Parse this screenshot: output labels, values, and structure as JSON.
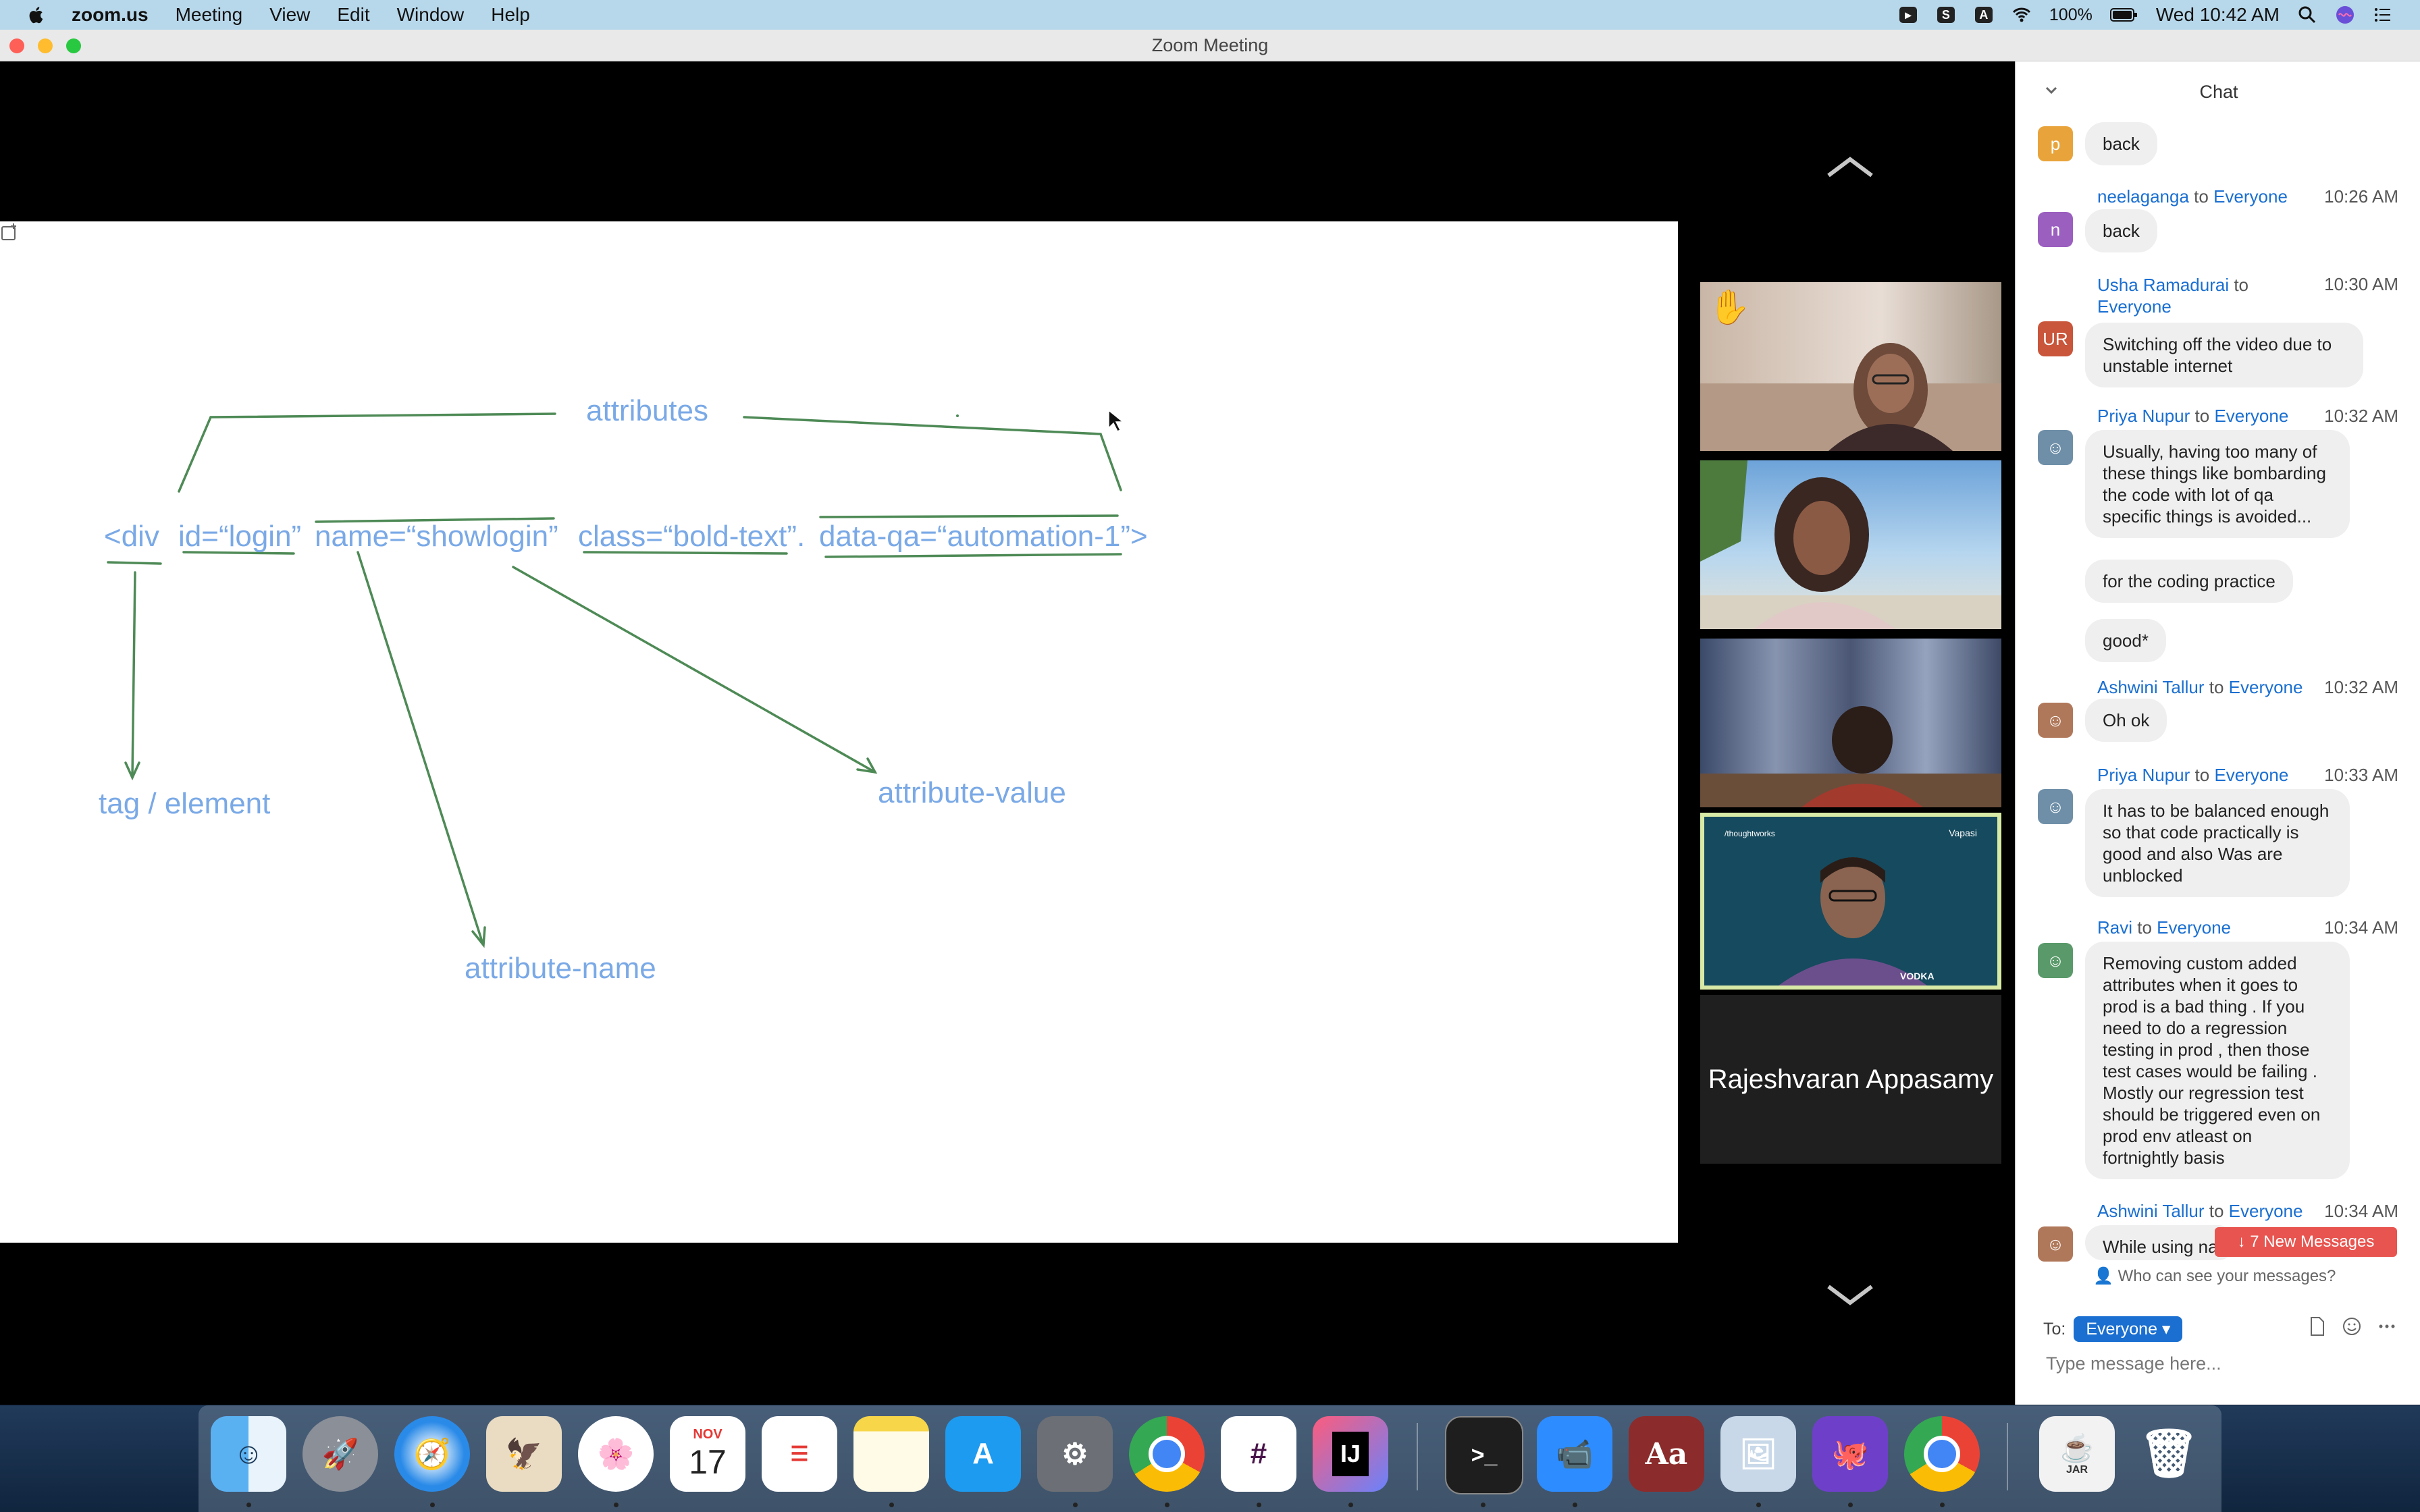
{
  "menubar": {
    "app": "zoom.us",
    "items": [
      "Meeting",
      "View",
      "Edit",
      "Window",
      "Help"
    ],
    "status_a": "A",
    "battery": "100%",
    "clock": "Wed 10:42 AM"
  },
  "window": {
    "title": "Zoom Meeting"
  },
  "whiteboard": {
    "attributes": "attributes",
    "tag_code": "<div",
    "id_code": "id=“login”",
    "name_code": "name=“showlogin”",
    "class_code": "class=“bold-text”.",
    "dataqa_code": "data-qa=“automation-1”>",
    "tag_label": "tag / element",
    "attr_value_label": "attribute-value",
    "attr_name_label": "attribute-name"
  },
  "participants": {
    "tile4_brand_left": "/thoughtworks",
    "tile4_brand_right": "Vapasi",
    "tile4_shirt": "VODKA",
    "name_tile": "Rajeshvaran Appasamy"
  },
  "chat": {
    "title": "Chat",
    "to_word": "to",
    "messages": [
      {
        "avatar": "p",
        "avatar_color": "#e8a43a",
        "sender": "",
        "recipient": "",
        "time": "",
        "text": "back"
      },
      {
        "avatar": "n",
        "avatar_color": "#9b5fc0",
        "sender": "neelaganga",
        "recipient": "Everyone",
        "time": "10:26 AM",
        "text": "back"
      },
      {
        "avatar": "UR",
        "avatar_color": "#c9553a",
        "sender": "Usha Ramadurai",
        "recipient": "Everyone",
        "time": "10:30 AM",
        "text": "Switching off the video due to unstable internet"
      },
      {
        "avatar": "",
        "avatar_color": "#6f8fa8",
        "sender": "Priya Nupur",
        "recipient": "Everyone",
        "time": "10:32 AM",
        "text": "Usually, having too many of these things like bombarding the code with lot of qa specific things is avoided..."
      },
      {
        "avatar": "",
        "avatar_color": "",
        "sender": "",
        "recipient": "",
        "time": "",
        "text": "for the coding practice"
      },
      {
        "avatar": "",
        "avatar_color": "",
        "sender": "",
        "recipient": "",
        "time": "",
        "text": "good*"
      },
      {
        "avatar": "",
        "avatar_color": "#b0785a",
        "sender": "Ashwini Tallur",
        "recipient": "Everyone",
        "time": "10:32 AM",
        "text": "Oh ok"
      },
      {
        "avatar": "",
        "avatar_color": "#6f8fa8",
        "sender": "Priya Nupur",
        "recipient": "Everyone",
        "time": "10:33 AM",
        "text": "It has to be balanced enough so that code practically is good and also Was are unblocked"
      },
      {
        "avatar": "",
        "avatar_color": "#5a9a6a",
        "sender": "Ravi",
        "recipient": "Everyone",
        "time": "10:34 AM",
        "text": "Removing custom added attributes when it goes to prod is a bad thing . If you need to do a regression testing in prod , then those test cases would be failing . Mostly our regression test should be triggered even on prod env atleast on fortnightly basis"
      },
      {
        "avatar": "",
        "avatar_color": "#b0785a",
        "sender": "Ashwini Tallur",
        "recipient": "Everyone",
        "time": "10:34 AM",
        "text": "While using na"
      }
    ],
    "new_messages": "↓ 7 New Messages",
    "who_can_see": "Who can see your messages?",
    "to_label": "To:",
    "to_value": "Everyone",
    "placeholder": "Type message here..."
  },
  "dock": {
    "calendar_month": "NOV",
    "calendar_day": "17",
    "intellij": "IJ",
    "dictionary": "Aa",
    "jar": "JAR",
    "terminal": ">_"
  }
}
